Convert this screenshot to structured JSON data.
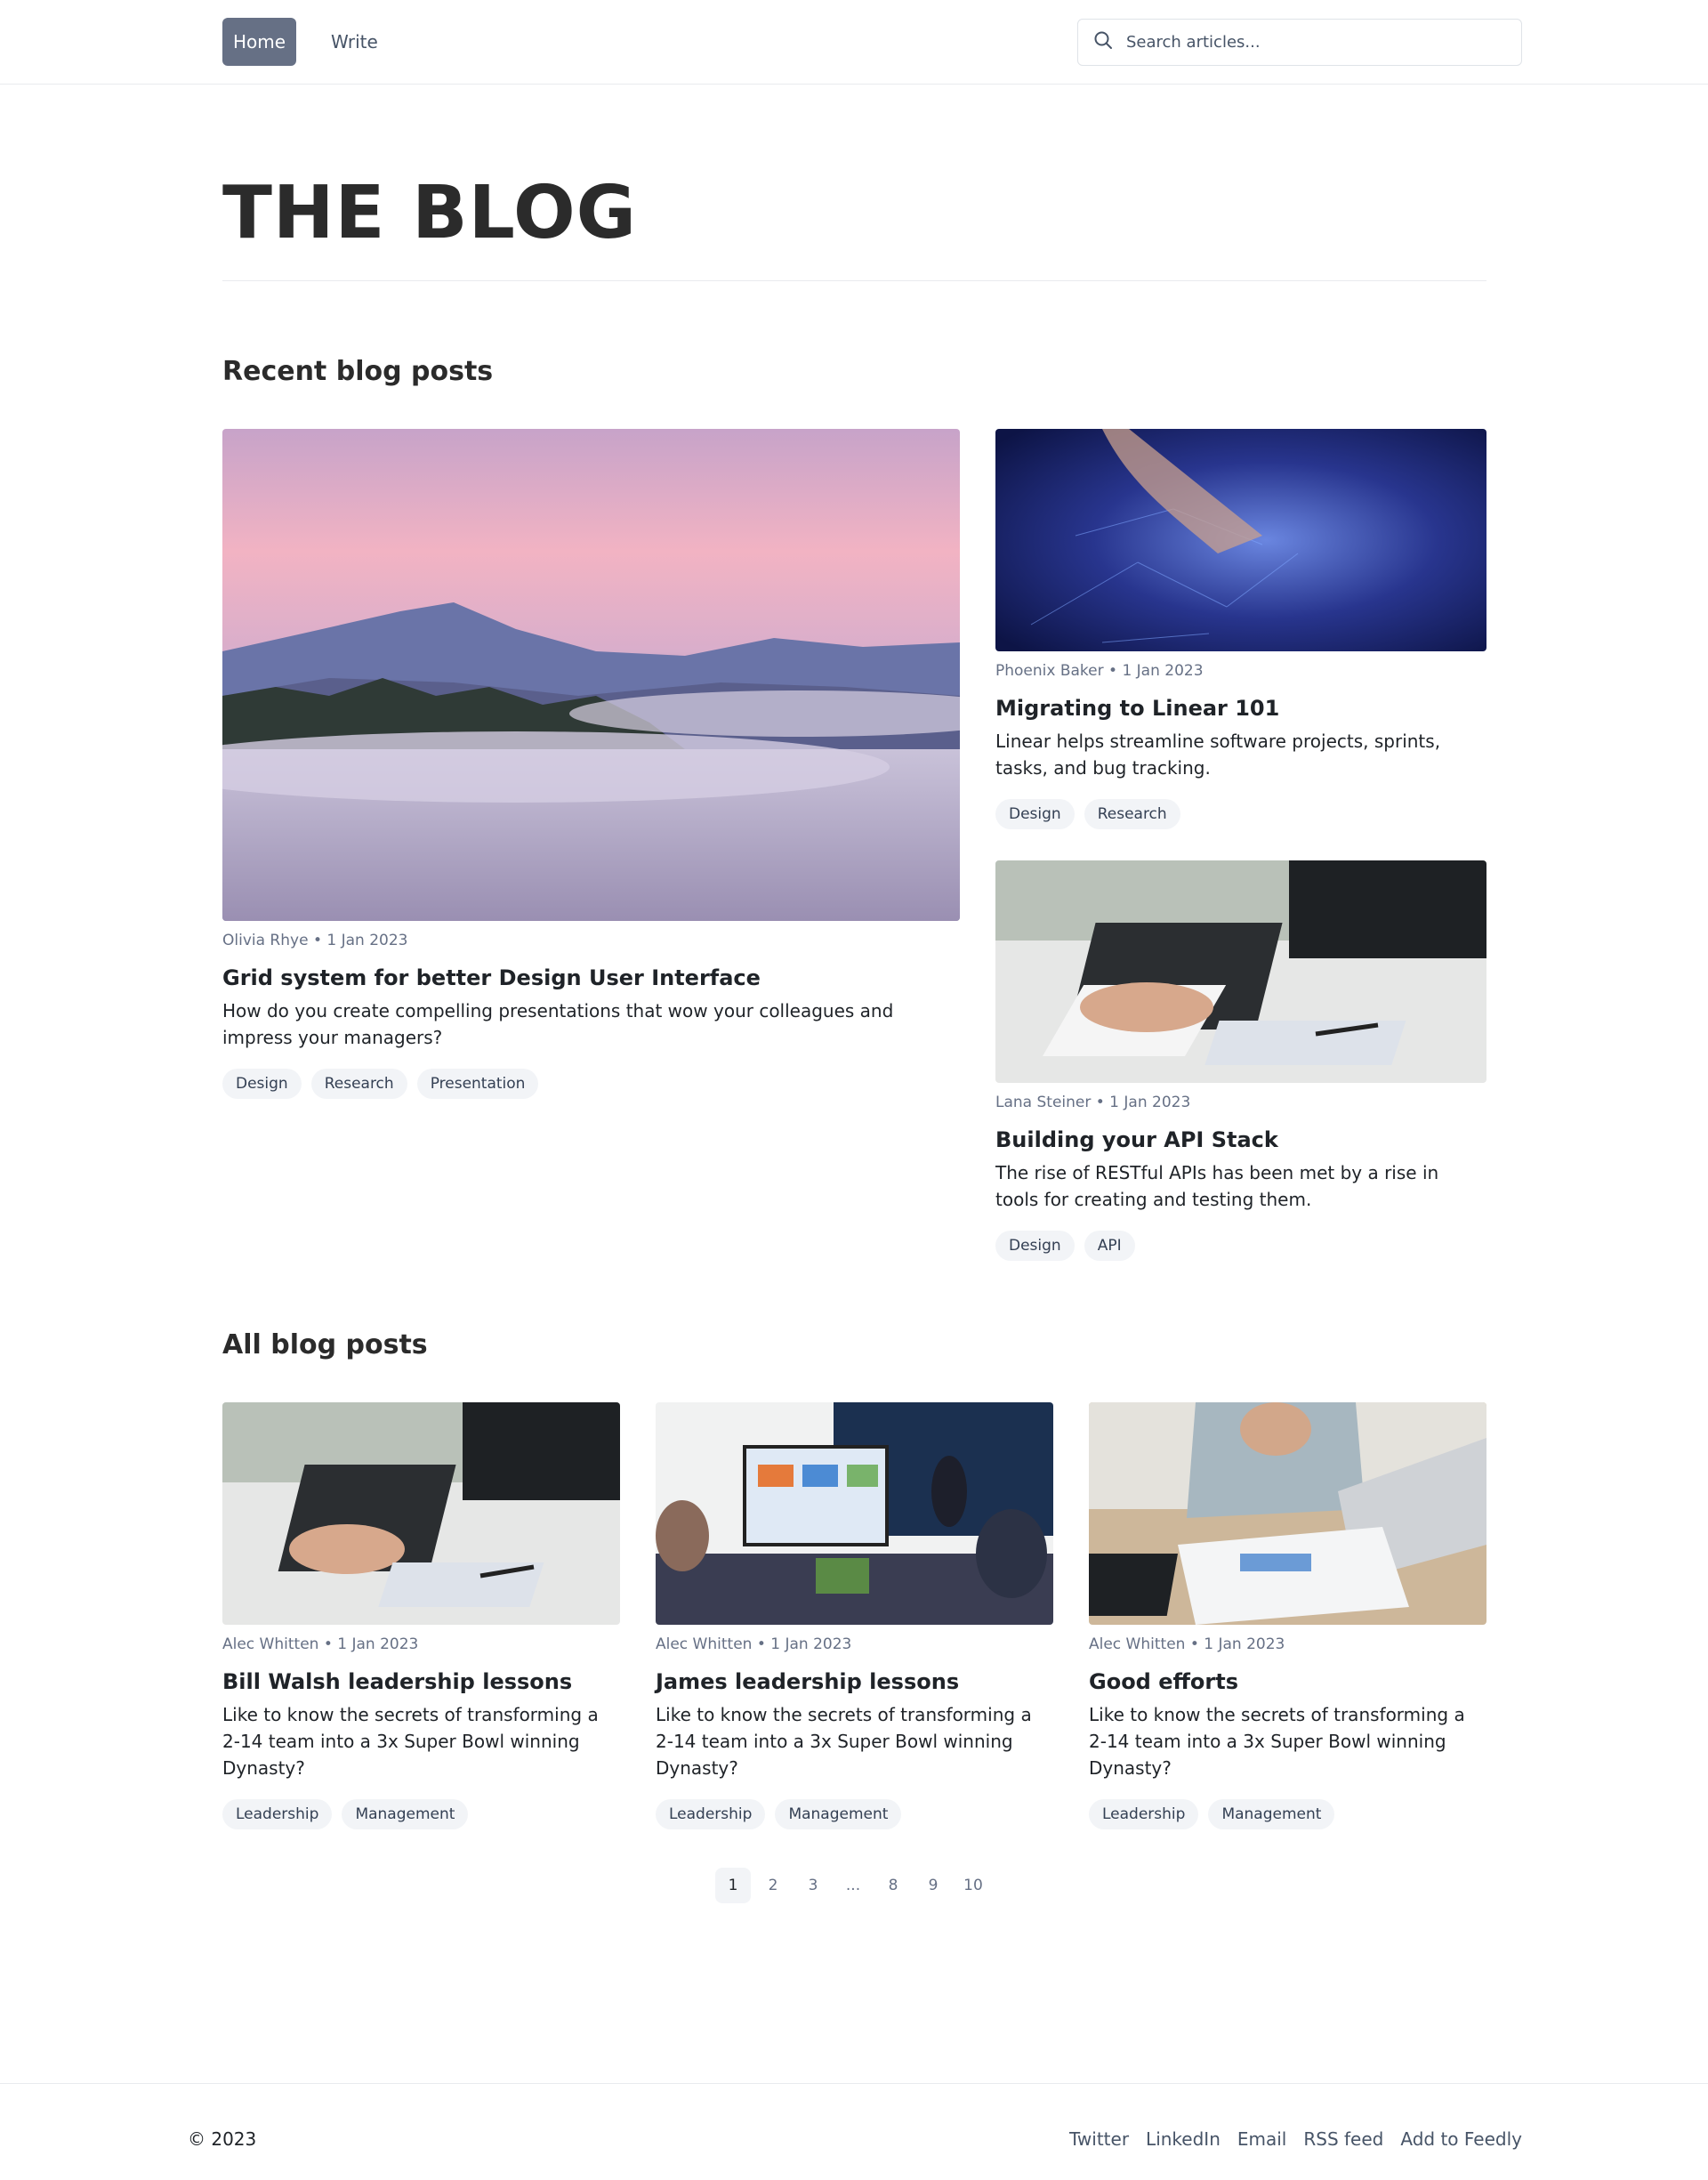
{
  "nav": {
    "home_label": "Home",
    "write_label": "Write",
    "search_placeholder": "Search articles..."
  },
  "page": {
    "title": "THE BLOG"
  },
  "recent": {
    "heading": "Recent blog posts",
    "posts": [
      {
        "author_date": "Olivia Rhye • 1 Jan 2023",
        "title": "Grid system for better Design User Interface",
        "excerpt": "How do you create compelling presentations that wow your colleagues and impress your managers?",
        "tags": [
          "Design",
          "Research",
          "Presentation"
        ]
      },
      {
        "author_date": "Phoenix Baker • 1 Jan 2023",
        "title": "Migrating to Linear 101",
        "excerpt": "Linear helps streamline software projects, sprints, tasks, and bug tracking.",
        "tags": [
          "Design",
          "Research"
        ]
      },
      {
        "author_date": "Lana Steiner • 1 Jan 2023",
        "title": "Building your API Stack",
        "excerpt": "The rise of RESTful APIs has been met by a rise in tools for creating and testing them.",
        "tags": [
          "Design",
          "API"
        ]
      }
    ]
  },
  "all": {
    "heading": "All blog posts",
    "posts": [
      {
        "author_date": "Alec Whitten • 1 Jan 2023",
        "title": "Bill Walsh leadership lessons",
        "excerpt": "Like to know the secrets of transforming a 2-14 team into a 3x Super Bowl winning Dynasty?",
        "tags": [
          "Leadership",
          "Management"
        ]
      },
      {
        "author_date": "Alec Whitten • 1 Jan 2023",
        "title": "James leadership lessons",
        "excerpt": "Like to know the secrets of transforming a 2-14 team into a 3x Super Bowl winning Dynasty?",
        "tags": [
          "Leadership",
          "Management"
        ]
      },
      {
        "author_date": "Alec Whitten • 1 Jan 2023",
        "title": "Good efforts",
        "excerpt": "Like to know the secrets of transforming a 2-14 team into a 3x Super Bowl winning Dynasty?",
        "tags": [
          "Leadership",
          "Management"
        ]
      }
    ]
  },
  "pagination": {
    "pages": [
      "1",
      "2",
      "3",
      "...",
      "8",
      "9",
      "10"
    ],
    "active": "1"
  },
  "footer": {
    "copyright": "© 2023",
    "links": [
      "Twitter",
      "LinkedIn",
      "Email",
      "RSS feed",
      "Add to Feedly"
    ]
  }
}
